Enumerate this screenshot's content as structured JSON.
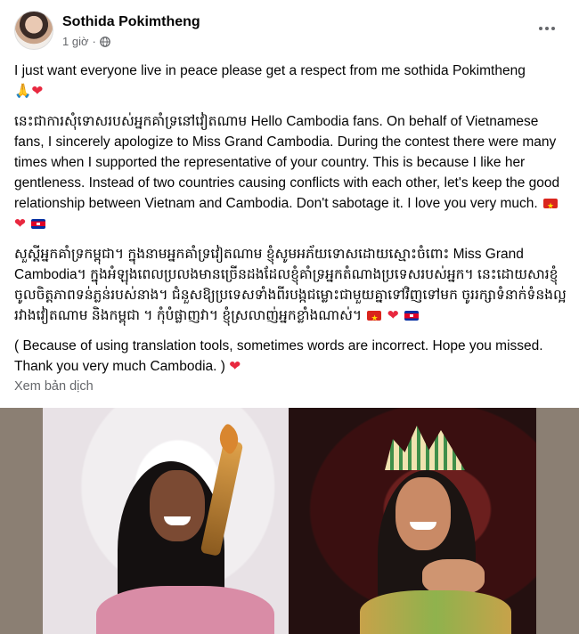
{
  "post": {
    "author": "Sothida Pokimtheng",
    "time": "1 giờ",
    "dot": "·",
    "audience_icon": "globe-icon"
  },
  "content": {
    "p1_text": "I just want everyone live in peace please get a respect from me sothida Pokimtheng ",
    "p1_emoji": "🙏",
    "p1_heart": "❤",
    "p2_text": "នេះជាការសុំទោសរបស់អ្នកគាំទ្រនៅវៀតណាម Hello Cambodia fans. On behalf of Vietnamese fans, I sincerely apologize to Miss Grand Cambodia. During the contest there were many times when I supported the representative of your country. This is because I like her gentleness. Instead of two countries causing conflicts with each other, let's keep the good relationship between Vietnam and Cambodia. Don't sabotage it. I love you very much. ",
    "p2_heart": "❤",
    "p3_text": "សួស្តីអ្នកគាំទ្រកម្ពុជា។ ក្នុងនាមអ្នកគាំទ្រវៀតណាម ខ្ញុំសូមអភ័យទោសដោយស្មោះចំពោះ Miss Grand Cambodia។ ក្នុងអំឡុងពេលប្រលងមានច្រើនដងដែលខ្ញុំគាំទ្រអ្នកតំណាងប្រទេសរបស់អ្នក។ នេះដោយសារខ្ញុំចូលចិត្តភាពទន់ភ្លន់របស់នាង។ ជំនួសឱ្យប្រទេសទាំងពីរបង្កជម្លោះជាមួយគ្នាទៅវិញទៅមក ចូររក្សាទំនាក់ទំនងល្អរវាងវៀតណាម និងកម្ពុជា ។ កុំបំផ្លាញវា។ ខ្ញុំស្រលាញ់អ្នកខ្លាំងណាស់។ ",
    "p3_heart": "❤",
    "p4_text": "( Because of using translation tools, sometimes words are incorrect. Hope you missed. Thank you very much Cambodia. ) ",
    "p4_heart": "❤"
  },
  "actions": {
    "translate_label": "Xem bản dịch"
  },
  "colors": {
    "secondary_text": "#65676b",
    "heart": "#e8283f",
    "photo_bg": "#8b7f73"
  }
}
